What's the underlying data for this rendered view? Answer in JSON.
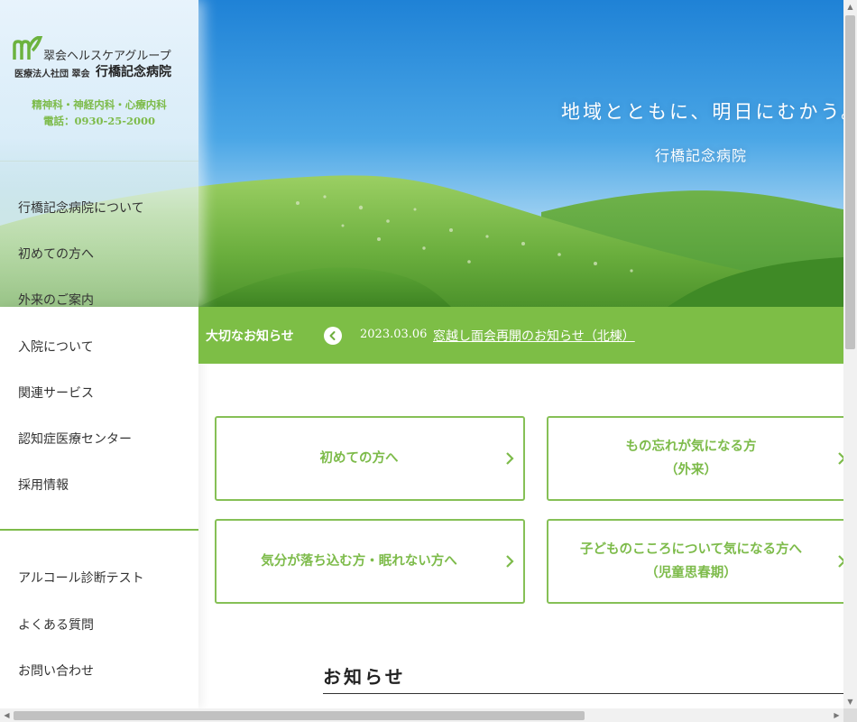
{
  "hero": {
    "tagline": "地域とともに、明日にむかう。",
    "subtitle": "行橋記念病院"
  },
  "sidebar": {
    "logo": {
      "group_name": "翠会ヘルスケアグループ",
      "corp_name": "医療法人社団 翠会",
      "hospital_name": "行橋記念病院"
    },
    "departments": "精神科・神経内科・心療内科",
    "phone": "電話：0930-25-2000",
    "nav": [
      "行橋記念病院について",
      "初めての方へ",
      "外来のご案内",
      "入院について",
      "関連サービス",
      "認知症医療センター",
      "採用情報"
    ],
    "sub_nav": [
      "アルコール診断テスト",
      "よくある質問",
      "お問い合わせ"
    ]
  },
  "notice": {
    "label": "大切なお知らせ",
    "date": "2023.03.06",
    "text": "窓越し面会再開のお知らせ（北棟）"
  },
  "cards": [
    {
      "line1": "初めての方へ",
      "line2": ""
    },
    {
      "line1": "もの忘れが気になる方",
      "line2": "（外来）"
    },
    {
      "line1": "気分が落ち込む方・眠れない方へ",
      "line2": ""
    },
    {
      "line1": "子どものこころについて気になる方へ",
      "line2": "（児童思春期）"
    }
  ],
  "news": {
    "title": "お知らせ"
  },
  "colors": {
    "brand_green": "#7dbe46",
    "card_border": "#86c056",
    "sky_blue": "#2f8fd8"
  },
  "icons": {
    "prev": "chevron-left-icon",
    "card": "chevron-right-icon"
  }
}
